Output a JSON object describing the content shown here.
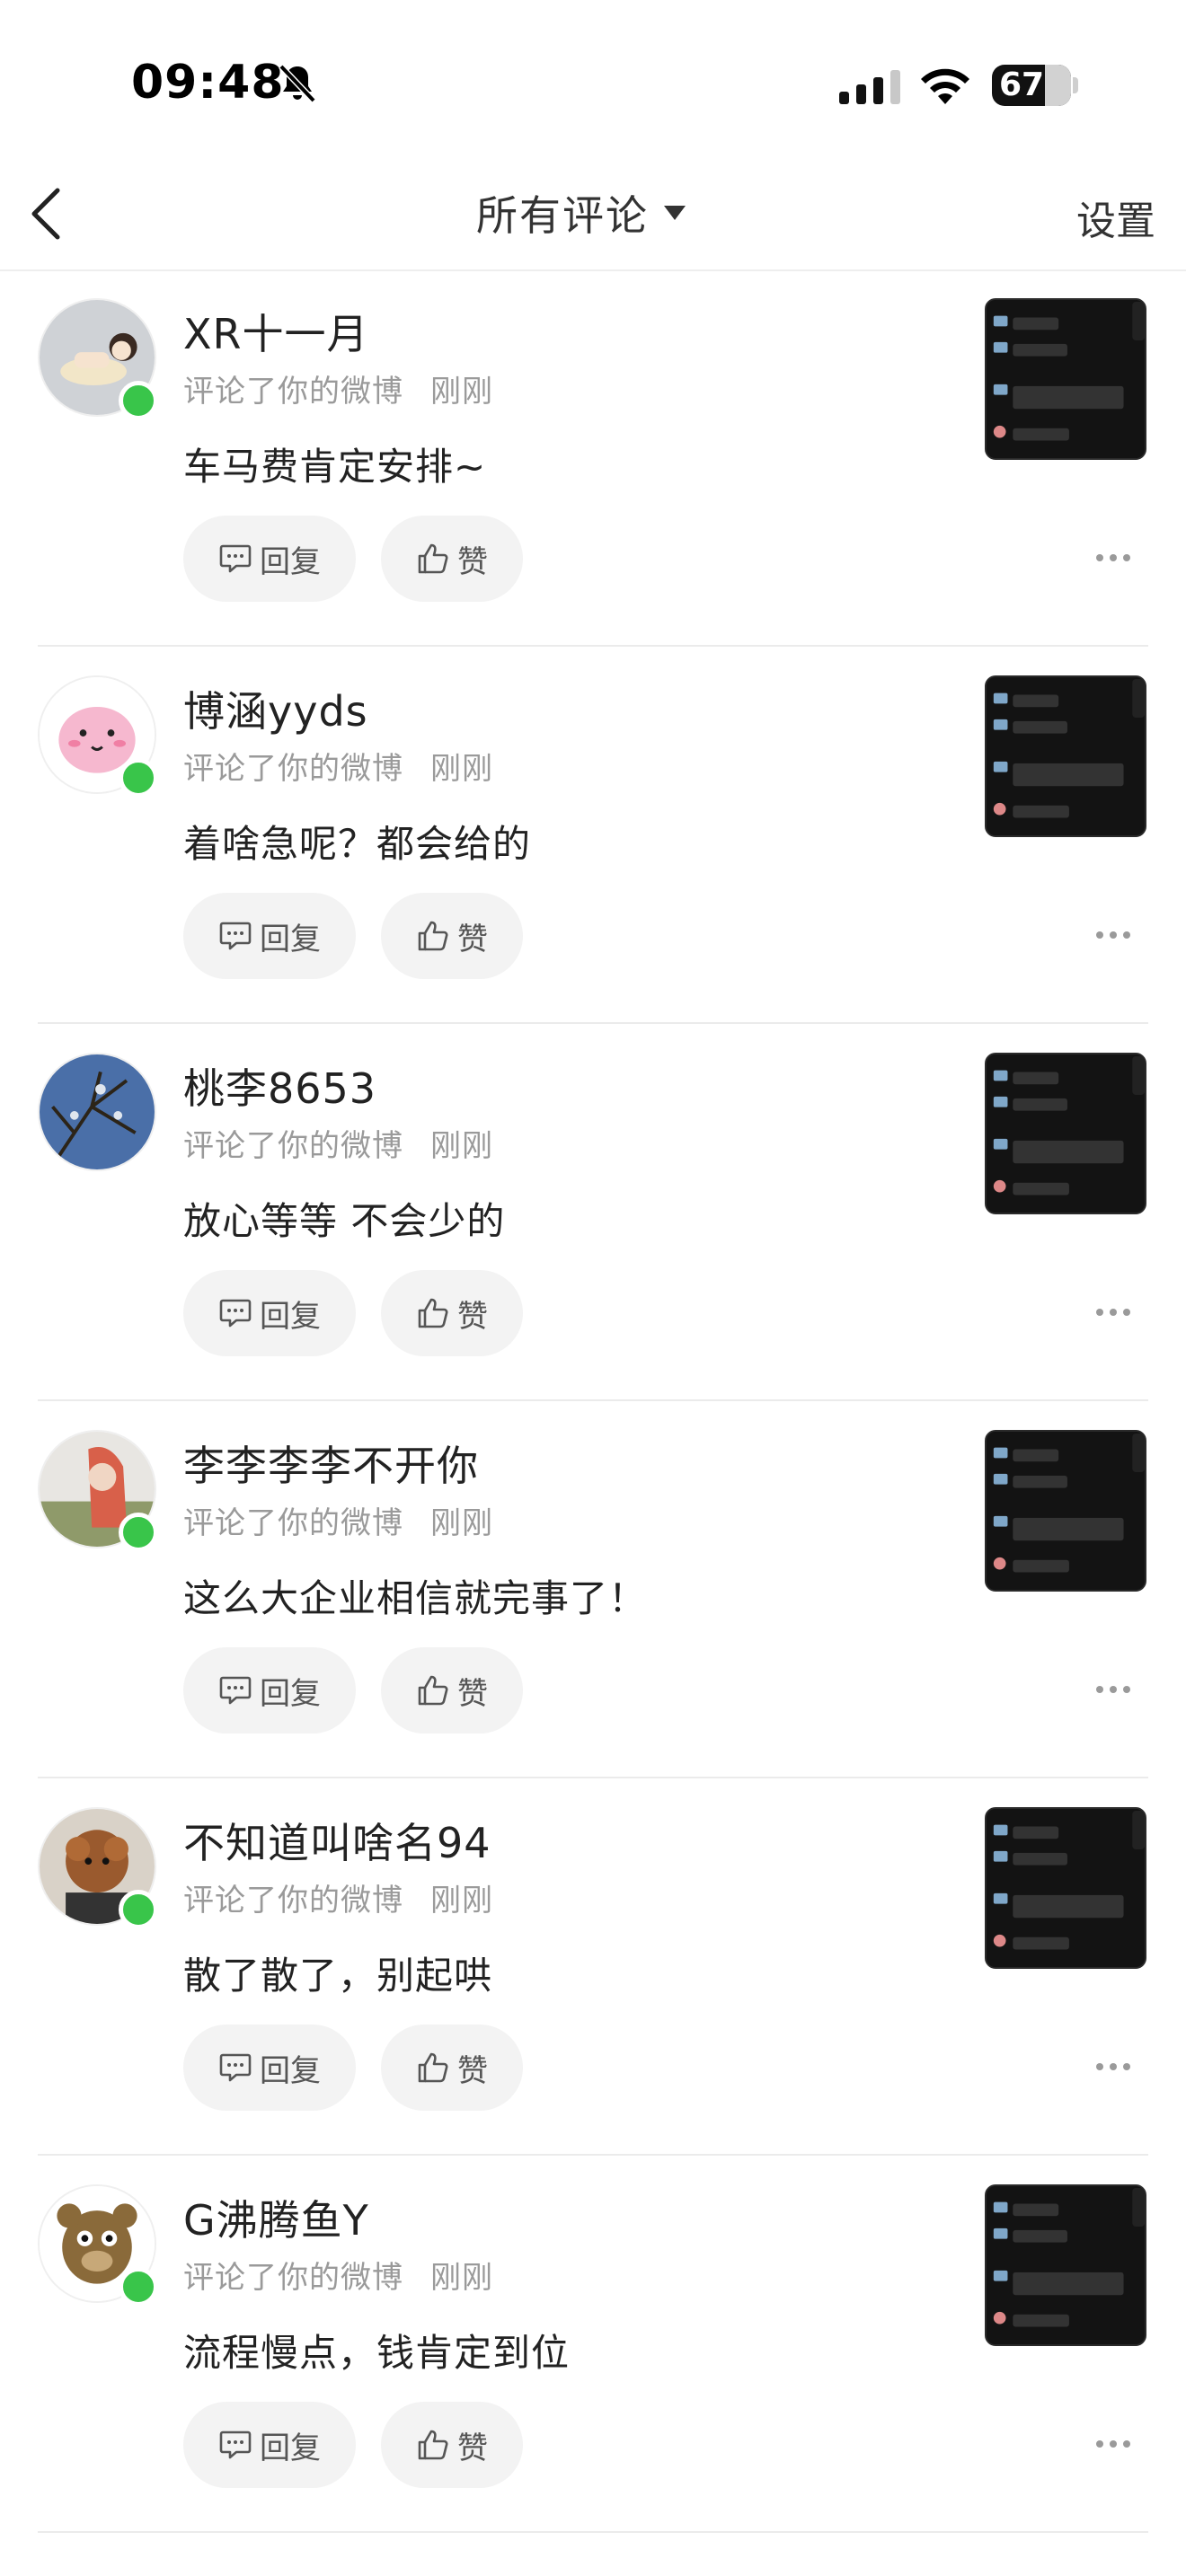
{
  "status_bar": {
    "time": "09:48",
    "battery": "67",
    "battery_level_percent": 67,
    "icons": [
      "bell-slash-icon",
      "cellular-signal-icon",
      "wifi-icon",
      "battery-icon"
    ]
  },
  "nav": {
    "back_icon": "chevron-left-icon",
    "title": "所有评论",
    "title_icon": "caret-down-icon",
    "settings": "设置"
  },
  "comments": [
    {
      "name": "XR十一月",
      "action": "评论了你的微博",
      "time": "刚刚",
      "text": "车马费肯定安排~",
      "reply": "回复",
      "like": "赞",
      "online": true
    },
    {
      "name": "博涵yyds",
      "action": "评论了你的微博",
      "time": "刚刚",
      "text": "着啥急呢？都会给的",
      "reply": "回复",
      "like": "赞",
      "online": true
    },
    {
      "name": "桃李8653",
      "action": "评论了你的微博",
      "time": "刚刚",
      "text": "放心等等 不会少的",
      "reply": "回复",
      "like": "赞",
      "online": false
    },
    {
      "name": "李李李李不开你",
      "action": "评论了你的微博",
      "time": "刚刚",
      "text": "这么大企业相信就完事了！",
      "reply": "回复",
      "like": "赞",
      "online": true
    },
    {
      "name": "不知道叫啥名94",
      "action": "评论了你的微博",
      "time": "刚刚",
      "text": "散了散了，别起哄",
      "reply": "回复",
      "like": "赞",
      "online": true
    },
    {
      "name": "G沸腾鱼Y",
      "action": "评论了你的微博",
      "time": "刚刚",
      "text": "流程慢点，钱肯定到位",
      "reply": "回复",
      "like": "赞",
      "online": true
    }
  ],
  "colors": {
    "online": "#39c54a",
    "divider": "#ebebeb",
    "button_bg": "#f3f3f3",
    "meta_text": "#9a9a9a"
  }
}
